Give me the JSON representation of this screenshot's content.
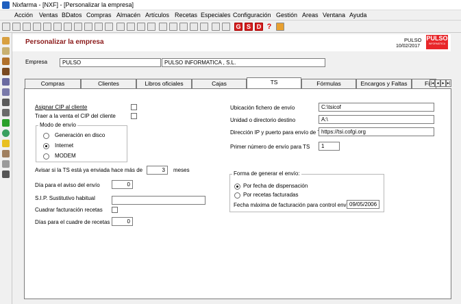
{
  "window": {
    "title": "Nixfarma - [NXF] - [Personalizar la empresa]"
  },
  "menu": [
    "Acción",
    "Ventas",
    "BDatos",
    "Compras",
    "Almacén",
    "Artículos",
    "Recetas",
    "Especiales",
    "Configuración",
    "Gestión",
    "Areas",
    "Ventana",
    "Ayuda"
  ],
  "toolbar": {
    "g_label": "G",
    "s_label": "S",
    "d_label": "D",
    "help_label": "?"
  },
  "header": {
    "title": "Personalizar la empresa",
    "user": "PULSO",
    "date": "10/02/2017",
    "logo_text": "PULSO",
    "logo_sub": "INFORMÁTICA"
  },
  "empresa": {
    "label": "Empresa",
    "code": "PULSO",
    "name": "PULSO INFORMATICA , S.L."
  },
  "tabs": [
    "Compras",
    "Clientes",
    "Libros oficiales",
    "Cajas",
    "TS",
    "Fórmulas",
    "Encargos y Faltas",
    "Fi"
  ],
  "ts": {
    "asignar_cip": "Asignar CIP al cliente",
    "traer_cip": "Traer a la venta el CIP del cliente",
    "modo_envio_title": "Modo de envío",
    "modo_options": [
      "Generación en disco",
      "Internet",
      "MODEM"
    ],
    "avisar_label": "Avisar si la TS está ya enviada hace más de",
    "avisar_value": "3",
    "meses": "meses",
    "dia_aviso_label": "Día para el aviso del envío",
    "dia_aviso_value": "0",
    "sip_label": "S.I.P. Sustitutivo habitual",
    "sip_value": "",
    "cuadrar_label": "Cuadrar facturación recetas",
    "dias_cuadre_label": "Días para el cuadre de recetas",
    "dias_cuadre_value": "0",
    "ubicacion_label": "Ubicación fichero de envío",
    "ubicacion_value": "C:\\tsicof",
    "unidad_label": "Unidad o directorio destino",
    "unidad_value": "A:\\",
    "ip_label": "Dirección IP y puerto para envío de TS",
    "ip_value": "https://tsi.cofgi.org",
    "primer_label": "Primer número de envío para TS",
    "primer_value": "1",
    "forma_title": "Forma de generar el envío:",
    "forma_options": [
      "Por fecha de dispensación",
      "Por recetas facturadas"
    ],
    "fecha_max_label": "Fecha máxima de facturación para control envíos",
    "fecha_max_value": "09/05/2006"
  },
  "colors": {
    "accent": "#8b1a1a",
    "logo_bg": "#e8262a",
    "panel": "#f0f0f0"
  }
}
